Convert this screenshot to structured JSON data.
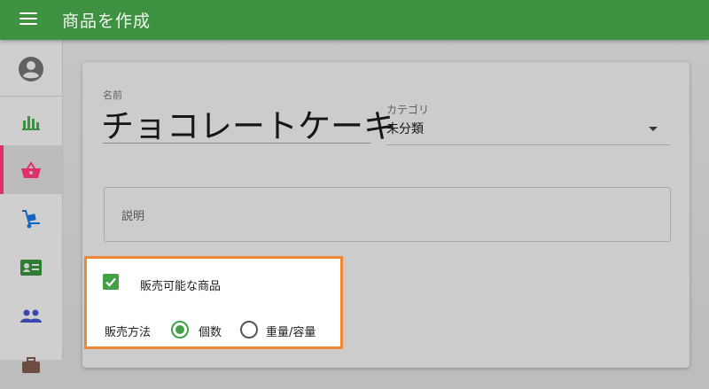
{
  "appbar": {
    "title": "商品を作成"
  },
  "sidebar": {
    "items": [
      {
        "icon": "account-circle-icon"
      },
      {
        "icon": "bar-chart-icon"
      },
      {
        "icon": "basket-icon",
        "active": true
      },
      {
        "icon": "hand-truck-icon"
      },
      {
        "icon": "id-card-icon"
      },
      {
        "icon": "people-icon"
      },
      {
        "icon": "briefcase-icon"
      }
    ]
  },
  "form": {
    "name_label": "名前",
    "name_value": "チョコレートケーキ",
    "category_label": "カテゴリ",
    "category_value": "未分類",
    "description_label": "説明",
    "available_label": "販売可能な商品",
    "available_checked": true,
    "sale_method_label": "販売方法",
    "sale_method_options": [
      "個数",
      "重量/容量"
    ],
    "sale_method_selected": "個数"
  },
  "colors": {
    "appbar": "#3d9140",
    "accent_green": "#43a047",
    "active_pink": "#e0306a",
    "highlight_orange": "#ef8733",
    "icon_blue": "#1565c0"
  }
}
